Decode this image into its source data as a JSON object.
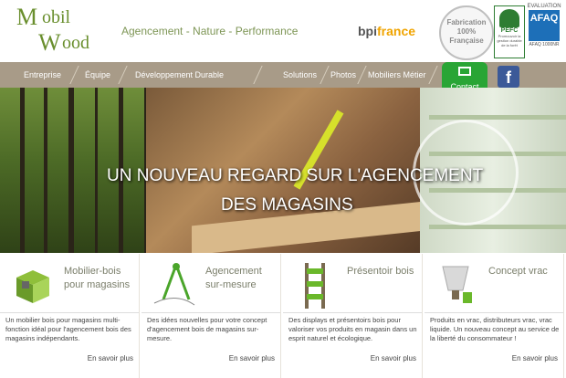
{
  "brand": {
    "logo_text": "MobilWood",
    "tagline": "Agencement - Nature - Performance"
  },
  "partners": {
    "bpi": "bpifrance",
    "seal_lines": [
      "Fabrication",
      "100%",
      "Française"
    ],
    "pefc": "PEFC",
    "pefc_small": "Promouvoir la gestion durable de la forêt",
    "afaq_top": "EVALUATION",
    "afaq_box": "AFAQ",
    "afaq_bottom": "AFAQ 1000NR"
  },
  "nav": {
    "items": [
      "Entreprise",
      "Équipe",
      "Développement Durable",
      "Solutions",
      "Photos",
      "Mobiliers Métier"
    ],
    "contact_label": "Contact",
    "facebook_label": "f"
  },
  "hero": {
    "line1": "UN NOUVEAU REGARD SUR L'AGENCEMENT",
    "line2": "DES MAGASINS"
  },
  "cards": [
    {
      "title": "Mobilier-bois pour magasins",
      "text": "Un mobilier bois pour magasins multi-fonction idéal pour l'agencement bois des magasins indépendants.",
      "more": "En savoir plus"
    },
    {
      "title": "Agencement sur-mesure",
      "text": "Des idées nouvelles pour votre concept d'agencement bois de magasins sur-mesure.",
      "more": "En savoir plus"
    },
    {
      "title": "Présentoir bois",
      "text": "Des displays et présentoirs bois pour valoriser vos produits en magasin dans un esprit naturel et écologique.",
      "more": "En savoir plus"
    },
    {
      "title": "Concept vrac",
      "text": "Produits en vrac, distributeurs vrac, vrac liquide. Un nouveau concept au service de la liberté du consommateur !",
      "more": "En savoir plus"
    }
  ],
  "colors": {
    "brand_green": "#6a8f2e",
    "nav_bg": "#a89b88",
    "contact_green": "#29a535",
    "facebook_blue": "#3b5998"
  }
}
